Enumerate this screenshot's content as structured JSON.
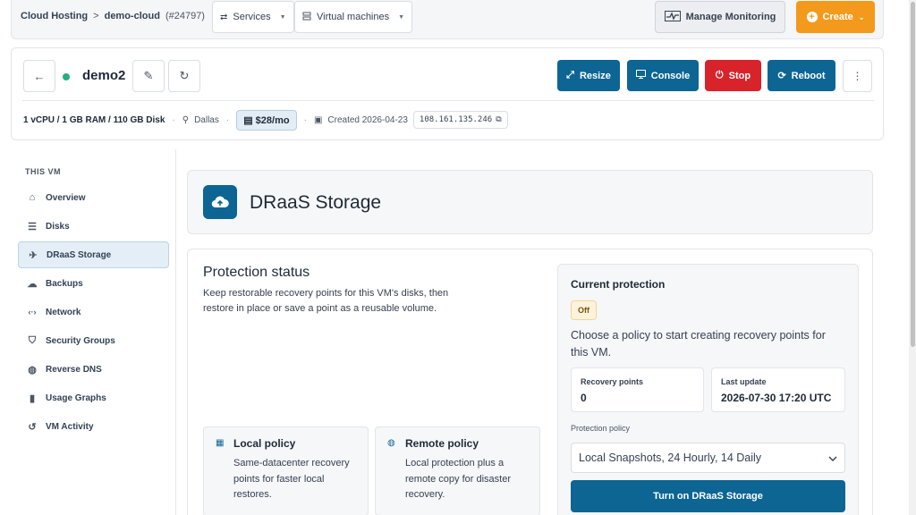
{
  "topbar": {
    "breadcrumb": {
      "root": "Cloud Hosting",
      "sep": ">",
      "current": "demo-cloud",
      "id": "(#24797)"
    },
    "services_label": "Services",
    "vms_label": "Virtual machines",
    "monitor_label": "Manage Monitoring",
    "create_label": "Create"
  },
  "vm": {
    "name": "demo2",
    "status_color": "#22b07d",
    "actions": {
      "resize": "Resize",
      "console": "Console",
      "stop": "Stop",
      "reboot": "Reboot"
    },
    "specs": "1 vCPU / 1 GB RAM / 110 GB Disk",
    "location": "Dallas",
    "price": "$28/mo",
    "created": "Created 2026-04-23",
    "ip": "108.161.135.246"
  },
  "sidebar": {
    "title": "THIS VM",
    "items": [
      {
        "label": "Overview",
        "icon": "home-icon"
      },
      {
        "label": "Disks",
        "icon": "disks-icon"
      },
      {
        "label": "DRaaS Storage",
        "icon": "satellite-icon"
      },
      {
        "label": "Backups",
        "icon": "cloud-icon"
      },
      {
        "label": "Network",
        "icon": "network-icon"
      },
      {
        "label": "Security Groups",
        "icon": "shield-icon"
      },
      {
        "label": "Reverse DNS",
        "icon": "globe-icon"
      },
      {
        "label": "Usage Graphs",
        "icon": "bar-chart-icon"
      },
      {
        "label": "VM Activity",
        "icon": "history-icon"
      }
    ]
  },
  "draas": {
    "title": "DRaaS Storage",
    "status_title": "Protection status",
    "status_desc": "Keep restorable recovery points for this VM's disks, then restore in place or save a point as a reusable volume.",
    "local": {
      "title": "Local policy",
      "desc": "Same-datacenter recovery points for faster local restores."
    },
    "remote": {
      "title": "Remote policy",
      "desc": "Local protection plus a remote copy for disaster recovery."
    },
    "current": {
      "title": "Current protection",
      "badge": "Off",
      "desc": "Choose a policy to start creating recovery points for this VM.",
      "recovery_label": "Recovery points",
      "recovery_value": "0",
      "last_label": "Last update",
      "last_value": "2026-07-30 17:20 UTC",
      "policy_label": "Protection policy",
      "policy_value": "Local Snapshots, 24 Hourly, 14 Daily",
      "turn_on_label": "Turn on DRaaS Storage"
    }
  },
  "colors": {
    "accent": "#0c6593",
    "danger": "#d8232a",
    "create": "#f39a1c"
  }
}
